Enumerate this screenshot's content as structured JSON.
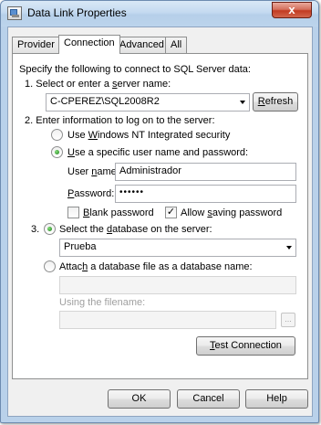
{
  "window": {
    "title": "Data Link Properties",
    "icon": "database-link-icon",
    "close_glyph": "x"
  },
  "tabs": [
    {
      "label": "Provider",
      "active": false
    },
    {
      "label": "Connection",
      "active": true
    },
    {
      "label": "Advanced",
      "active": false
    },
    {
      "label": "All",
      "active": false
    }
  ],
  "connection": {
    "intro": "Specify the following to connect to SQL Server data:",
    "step1": {
      "number": "1.",
      "label_prefix": "Select or enter a ",
      "label_accel": "s",
      "label_suffix": "erver name:",
      "server_value": "C-CPEREZ\\SQL2008R2",
      "refresh_accel": "R",
      "refresh_rest": "efresh"
    },
    "step2": {
      "number": "2.",
      "label": "Enter information to log on to the server:",
      "windows_auth": {
        "prefix": "Use ",
        "accel": "W",
        "suffix": "indows NT Integrated security",
        "checked": false
      },
      "specific_auth": {
        "accel": "U",
        "suffix": "se a specific user name and password:",
        "checked": true
      },
      "username": {
        "prefix": "User ",
        "accel": "n",
        "suffix": "ame:",
        "value": "Administrador"
      },
      "password": {
        "accel": "P",
        "suffix": "assword:",
        "value": "••••••"
      },
      "blank_password": {
        "accel": "B",
        "suffix": "lank password",
        "checked": false
      },
      "allow_saving": {
        "prefix": "Allow ",
        "accel": "s",
        "suffix": "aving password",
        "checked": true,
        "glyph": "✓"
      }
    },
    "step3": {
      "number": "3.",
      "select_db": {
        "prefix": "Select the ",
        "accel": "d",
        "suffix": "atabase on the server:",
        "checked": true,
        "value": "Prueba"
      },
      "attach_db": {
        "prefix": "Attac",
        "accel": "h",
        "suffix": " a database file as a database name:",
        "checked": false,
        "value": ""
      },
      "filename_label": "Using the filename:",
      "filename_value": "",
      "browse_label": "..."
    },
    "test_connection": {
      "accel": "T",
      "suffix": "est Connection"
    }
  },
  "footer": {
    "ok": "OK",
    "cancel": "Cancel",
    "help": "Help"
  }
}
